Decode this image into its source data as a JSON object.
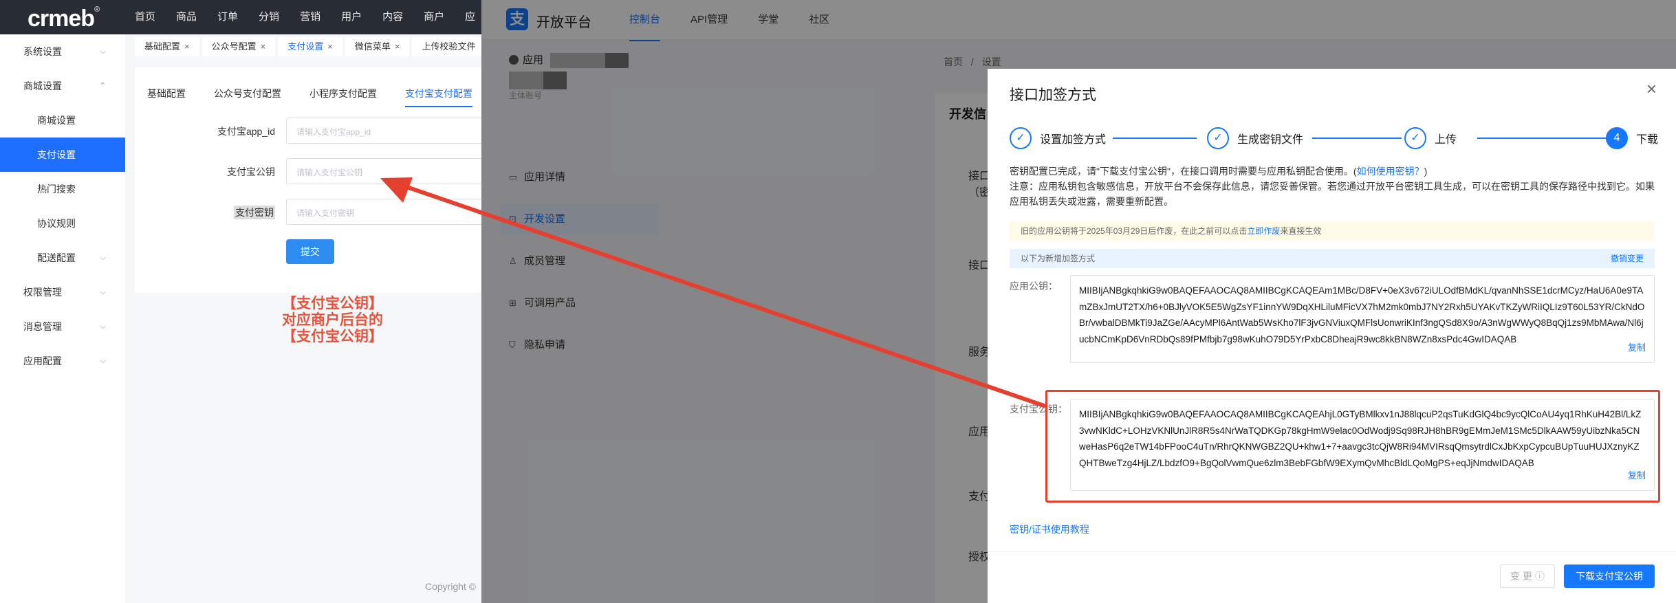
{
  "crmeb": {
    "logo": "crmeb",
    "logo_mark": "®",
    "topnav": [
      "首页",
      "商品",
      "订单",
      "分销",
      "营销",
      "用户",
      "内容",
      "商户",
      "应"
    ],
    "sidebar": [
      {
        "label": "系统设置",
        "chev": "⌵"
      },
      {
        "label": "商城设置",
        "chev": "⌃"
      },
      {
        "label": "商城设置",
        "chev": ""
      },
      {
        "label": "支付设置",
        "chev": ""
      },
      {
        "label": "热门搜索",
        "chev": ""
      },
      {
        "label": "协议规则",
        "chev": ""
      },
      {
        "label": "配送配置",
        "chev": "⌵"
      },
      {
        "label": "权限管理",
        "chev": "⌵"
      },
      {
        "label": "消息管理",
        "chev": "⌵"
      },
      {
        "label": "应用配置",
        "chev": "⌵"
      }
    ],
    "tabs": [
      "基础配置",
      "公众号配置",
      "支付设置",
      "微信菜单",
      "上传校验文件"
    ],
    "tab_close": "×",
    "subtabs": [
      "基础配置",
      "公众号支付配置",
      "小程序支付配置",
      "支付宝支付配置"
    ],
    "form": [
      {
        "label": "支付宝app_id",
        "placeholder": "请输入支付宝app_id"
      },
      {
        "label": "支付宝公钥",
        "placeholder": "请输入支付宝公钥"
      },
      {
        "label": "支付密钥",
        "placeholder": "请输入支付密钥"
      }
    ],
    "submit": "提交",
    "annotation": [
      "【支付宝公钥】",
      "对应商户后台的",
      "【支付宝公钥】"
    ],
    "copyright": "Copyright ©"
  },
  "alipay": {
    "logo_glyph": "支",
    "brand": "开放平台",
    "nav": [
      "控制台",
      "API管理",
      "学堂",
      "社区"
    ],
    "app_name_prefix": "应用",
    "main_account_label": "主体账号",
    "menu": [
      {
        "icon": "▭",
        "label": "应用详情"
      },
      {
        "icon": "⊡",
        "label": "开发设置"
      },
      {
        "icon": "♙",
        "label": "成员管理"
      },
      {
        "icon": "⊞",
        "label": "可调用产品"
      },
      {
        "icon": "⛉",
        "label": "隐私申请"
      }
    ],
    "breadcrumb": [
      "首页",
      "/",
      "设置"
    ],
    "panel_title": "开发信",
    "panel_labels": [
      "接口",
      "（密",
      "接口",
      "服务",
      "应用",
      "支付",
      "授权"
    ]
  },
  "modal": {
    "title": "接口加签方式",
    "close": "×",
    "steps": [
      {
        "num": "✓",
        "label": "设置加签方式"
      },
      {
        "num": "✓",
        "label": "生成密钥文件"
      },
      {
        "num": "✓",
        "label": "上传"
      },
      {
        "num": "4",
        "label": "下载"
      }
    ],
    "desc_line1_a": "密钥配置已完成，请\"下载支付宝公钥\"，在接口调用时需要与应用私钥配合使用。(",
    "desc_line1_link": "如何使用密钥？",
    "desc_line1_b": ")",
    "desc_line2": "注意：应用私钥包含敏感信息，开放平台不会保存此信息，请您妥善保管。若您通过开放平台密钥工具生成，可以在密钥工具的保存路径中找到它。如果应用私钥丢失或泄露，需要重新配置。",
    "notice_yellow_a": "旧的应用公钥将于2025年03月29日后作废，在此之前可以点击",
    "notice_yellow_link": "立即作废",
    "notice_yellow_b": "来直接生效",
    "notice_blue": "以下为新增加签方式",
    "notice_blue_action": "撤销变更",
    "app_pubkey_label": "应用公钥：",
    "app_pubkey": "MIIBIjANBgkqhkiG9w0BAQEFAAOCAQ8AMIIBCgKCAQEAm1MBc/D8FV+0eX3v672iULOdfBMdKL/qvanNhSSE1dcrMCyz/HaU6A0e9TAmZBxJmUT2TX/h6+0BJlyVOK5E5WgZsYF1innYW9DqXHLiluMFicVX7hM2mk0mbJ7NY2Rxh5UYAKvTKZyWRiIQLIz9T60L53YR/CkNdOBr/vwbalDBMkTi9JaZGe/AAcyMPl6AntWab5WsKho7lF3jvGNViuxQMFlsUonwriKInf3ngQSd8X9o/A3nWgWWyQ8BqQj1zs9MbMAwa/Nl6jucbNCmKpD6VnRDbQs89fPMfbjb7g98wKuhO79D5YrPxbC8DheajR9wc8kkBN8WZn8xsPdc4GwIDAQAB",
    "alipay_pubkey_label": "支付宝公钥：",
    "alipay_pubkey": "MIIBIjANBgkqhkiG9w0BAQEFAAOCAQ8AMIIBCgKCAQEAhjL0GTyBMlkxv1nJ88lqcuP2qsTuKdGlQ4bc9ycQlCoAU4yq1RhKuH42Bl/LkZ3vwNKldC+LOHzVKNlUnJlR8R5s4NrWaTQDKGp78kgHmW9elac0OdWodj9Sq98RJH8hBR9gEMmJeM1SMc5DlkAAW59yUibzNka5CNweHasP6q2eTW14bFPooC4uTn/RhrQKNWGBZ2QU+khw1+7+aavgc3tcQjW8Ri94MVIRsqQmsytrdlCxJbKxpCypcuBUpTuuHUJXznyKZQHTBweTzg4HjLZ/LbdzfO9+BgQolVwmQue6zlm3BebFGbfW9EXymQvMhcBldLQoMgPS+eqJjNmdwIDAQAB",
    "copy": "复制",
    "tutorial": "密钥/证书使用教程",
    "btn_change": "变 更 ⓘ",
    "btn_download": "下载支付宝公钥"
  },
  "colors": {
    "primary": "#1677ff",
    "annotation": "#e5533c",
    "crmeb_active": "#1e6fff"
  }
}
